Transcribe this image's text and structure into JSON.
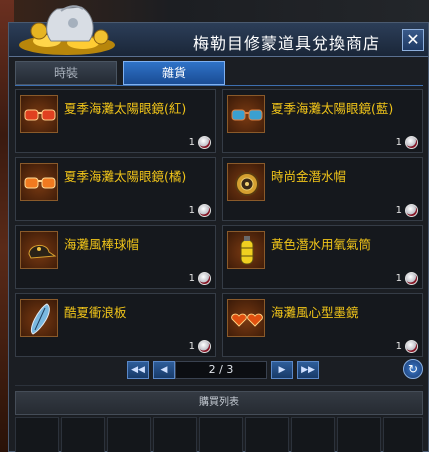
{
  "window": {
    "title": "梅勒目修蒙道具兌換商店",
    "close_label": "✕"
  },
  "tabs": [
    {
      "label": "時裝",
      "active": false
    },
    {
      "label": "雜貨",
      "active": true
    }
  ],
  "items": [
    {
      "name": "夏季海灘太陽眼鏡(紅)",
      "qty": "1",
      "icon": "red-sunglasses-icon"
    },
    {
      "name": "夏季海灘太陽眼鏡(藍)",
      "qty": "1",
      "icon": "blue-sunglasses-icon"
    },
    {
      "name": "夏季海灘太陽眼鏡(橘)",
      "qty": "1",
      "icon": "orange-sunglasses-icon"
    },
    {
      "name": "時尚金潛水帽",
      "qty": "1",
      "icon": "gold-diving-cap-icon"
    },
    {
      "name": "海灘風棒球帽",
      "qty": "1",
      "icon": "baseball-cap-icon"
    },
    {
      "name": "黃色潛水用氧氣筒",
      "qty": "1",
      "icon": "oxygen-tank-icon"
    },
    {
      "name": "酷夏衝浪板",
      "qty": "1",
      "icon": "surfboard-icon"
    },
    {
      "name": "海灘風心型墨鏡",
      "qty": "1",
      "icon": "heart-sunglasses-icon"
    }
  ],
  "pager": {
    "current_page": 2,
    "total_pages": 3,
    "display": "2 / 3"
  },
  "cart": {
    "header": "購買列表",
    "slot_count": 9
  },
  "colors": {
    "item_name": "#f0c419",
    "active_tab": "#2f73c8",
    "titlebar": "#2c3e58"
  }
}
